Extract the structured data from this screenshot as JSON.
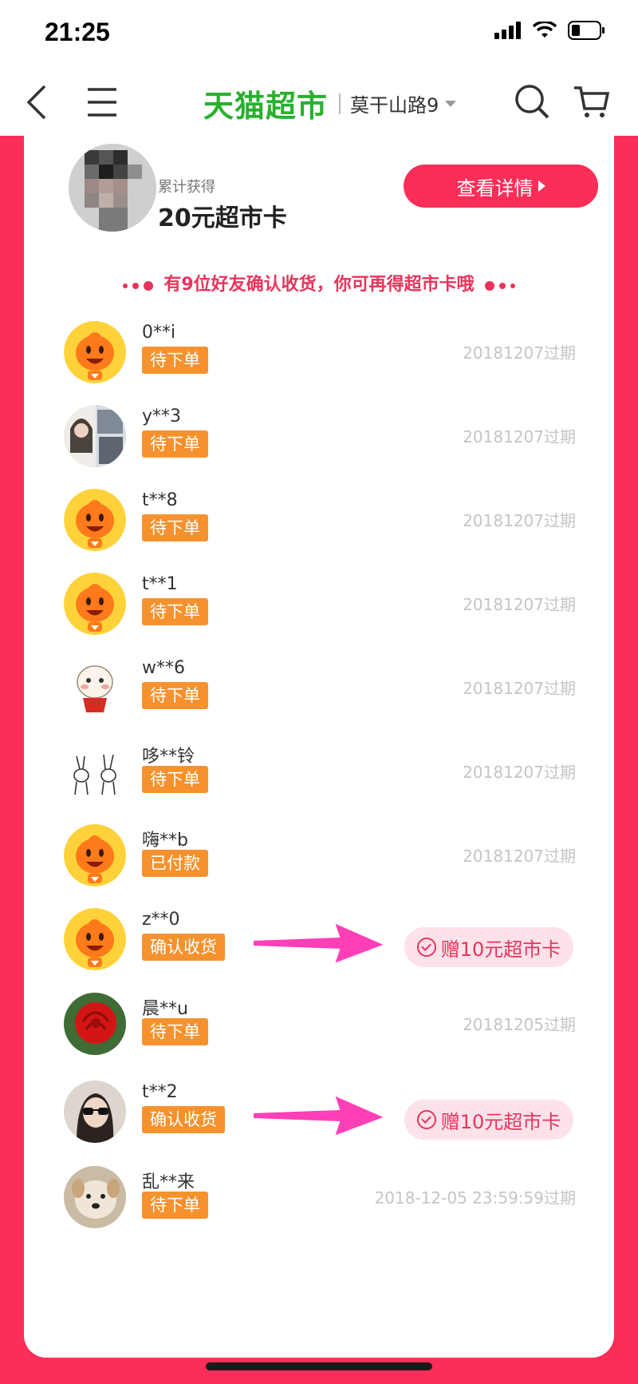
{
  "status_bar": {
    "time": "21:25"
  },
  "nav": {
    "brand": "天猫超市",
    "location": "莫干山路9",
    "icons": [
      "back-icon",
      "menu-icon",
      "search-icon",
      "cart-icon"
    ]
  },
  "summary": {
    "label": "累计获得",
    "value": "20元超市卡",
    "detail_button": "查看详情"
  },
  "notice": "有9位好友确认收货，你可再得超市卡哦",
  "colors": {
    "accent": "#fb2e58",
    "badge": "#f6922e",
    "brand": "#29b02f"
  },
  "friends": [
    {
      "name": "0**i",
      "status": "待下单",
      "expire": "20181207过期"
    },
    {
      "name": "y**3",
      "status": "待下单",
      "expire": "20181207过期"
    },
    {
      "name": "t**8",
      "status": "待下单",
      "expire": "20181207过期"
    },
    {
      "name": "t**1",
      "status": "待下单",
      "expire": "20181207过期"
    },
    {
      "name": "w**6",
      "status": "待下单",
      "expire": "20181207过期"
    },
    {
      "name": "哆**铃",
      "status": "待下单",
      "expire": "20181207过期"
    },
    {
      "name": "嗨**b",
      "status": "已付款",
      "expire": "20181207过期"
    },
    {
      "name": "z**0",
      "status": "确认收货",
      "reward": "赠10元超市卡"
    },
    {
      "name": "晨**u",
      "status": "待下单",
      "expire": "20181205过期"
    },
    {
      "name": "t**2",
      "status": "确认收货",
      "reward": "赠10元超市卡"
    },
    {
      "name": "乱**来",
      "status": "待下单",
      "expire": "2018-12-05 23:59:59过期"
    }
  ]
}
